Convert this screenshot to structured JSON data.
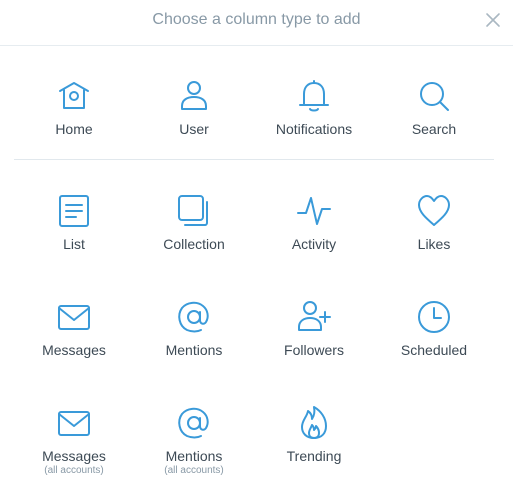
{
  "header": {
    "title": "Choose a column type to add"
  },
  "columns": {
    "home": {
      "label": "Home"
    },
    "user": {
      "label": "User"
    },
    "notifications": {
      "label": "Notifications"
    },
    "search": {
      "label": "Search"
    },
    "list": {
      "label": "List"
    },
    "collection": {
      "label": "Collection"
    },
    "activity": {
      "label": "Activity"
    },
    "likes": {
      "label": "Likes"
    },
    "messages": {
      "label": "Messages"
    },
    "mentions": {
      "label": "Mentions"
    },
    "followers": {
      "label": "Followers"
    },
    "scheduled": {
      "label": "Scheduled"
    },
    "messages_all": {
      "label": "Messages",
      "sublabel": "(all accounts)"
    },
    "mentions_all": {
      "label": "Mentions",
      "sublabel": "(all accounts)"
    },
    "trending": {
      "label": "Trending"
    }
  },
  "colors": {
    "accent": "#3a9ad9",
    "title": "#8899a6",
    "label": "#3d4a55"
  }
}
